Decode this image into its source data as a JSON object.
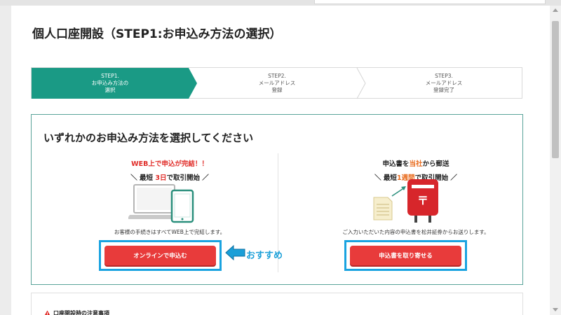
{
  "page": {
    "title": "個人口座開設（STEP1:お申込み方法の選択）"
  },
  "steps": [
    {
      "line1": "STEP1.",
      "line2": "お申込み方法の",
      "line3": "選択",
      "active": true
    },
    {
      "line1": "STEP2.",
      "line2": "メールアドレス",
      "line3": "登録",
      "active": false
    },
    {
      "line1": "STEP3.",
      "line2": "メールアドレス",
      "line3": "登録完了",
      "active": false
    }
  ],
  "panel": {
    "heading": "いずれかのお申込み方法を選択してください"
  },
  "online": {
    "tag_prefix": "WEB上で",
    "tag_highlight": "申込が完結！！",
    "speed_open": "＼ 最短 ",
    "speed_highlight": "3日",
    "speed_close": "で取引開始 ／",
    "description": "お客様の手続きはすべてWEB上で完結します。",
    "button_label": "オンラインで申込む",
    "recommend_label": "おすすめ"
  },
  "mail": {
    "tag_prefix": "申込書を",
    "tag_highlight": "当社",
    "tag_suffix": "から郵送",
    "speed_open": "＼ 最短",
    "speed_highlight": "1週間",
    "speed_close": "で取引開始 ／",
    "description": "ご入力いただいた内容の申込書を松井証券からお送りします。",
    "button_label": "申込書を取り寄せる"
  },
  "notice": {
    "title": "口座開設時の注意事項"
  },
  "colors": {
    "step_active": "#1a9a85",
    "panel_border": "#5aa39a",
    "button": "#e83b3b",
    "highlight_frame": "#1aa3e0",
    "text_red": "#e02b27",
    "text_orange": "#e86b1d",
    "recommend": "#1a9fd8"
  },
  "icons": {
    "online": "laptop-and-tablet-icon",
    "mail": "postbox-and-document-icon",
    "notice": "warning-triangle-icon",
    "arrow": "left-arrow-icon"
  }
}
